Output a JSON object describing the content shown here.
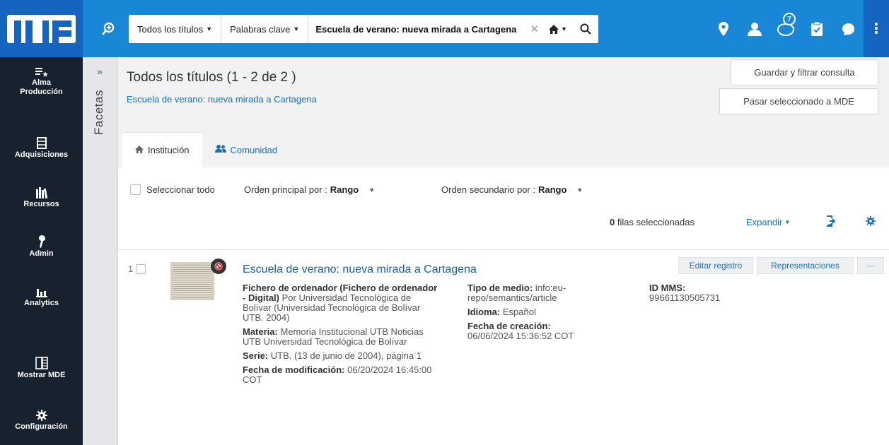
{
  "topbar": {
    "search_scope": "Todos los títulos",
    "search_field": "Palabras clave",
    "search_query": "Escuela de verano: nueva mirada a Cartagena",
    "notification_count": "7",
    "icons": [
      "zoom-search-icon",
      "location-pin-icon",
      "user-icon",
      "notifications-icon",
      "clipboard-icon",
      "chat-icon",
      "more-vertical-icon"
    ]
  },
  "nav": {
    "items": [
      {
        "label_1": "Alma",
        "label_2": "Producción",
        "icon": "list-star-icon"
      },
      {
        "label": "Adquisiciones",
        "icon": "ledger-icon"
      },
      {
        "label": "Recursos",
        "icon": "books-icon"
      },
      {
        "label": "Admin",
        "icon": "wrench-icon"
      },
      {
        "label": "Analytics",
        "icon": "bar-chart-icon"
      },
      {
        "label": "Mostrar MDE",
        "icon": "mde-icon"
      },
      {
        "label": "Configuración",
        "icon": "gear-icon"
      }
    ]
  },
  "facets": {
    "label": "Facetas",
    "toggle": "»"
  },
  "main": {
    "title": "Todos los títulos (1 - 2 de 2 )",
    "subtitle": "Escuela de verano: nueva mirada a Cartagena",
    "save_filter_button": "Guardar y filtrar consulta",
    "move_to_mde_button": "Pasar seleccionado a MDE",
    "tabs": [
      {
        "label": "Institución",
        "icon": "home-icon"
      },
      {
        "label": "Comunidad",
        "icon": "users-icon"
      }
    ]
  },
  "toolbar": {
    "select_all": "Seleccionar todo",
    "primary_sort_label": "Orden principal por :",
    "primary_sort_value": "Rango",
    "secondary_sort_label": "Orden secundario por :",
    "secondary_sort_value": "Rango",
    "selected_count": "0",
    "selected_label": "filas seleccionadas",
    "expand": "Expandir"
  },
  "result": {
    "index": "1",
    "title": "Escuela de verano: nueva mirada a Cartagena",
    "buttons": {
      "edit": "Editar registro",
      "representations": "Representaciones",
      "more": "···"
    },
    "format_bold": "Fichero de ordenador (Fichero de ordenador - Digital)",
    "format_rest": "Por Universidad Tecnológica de Bolívar (Universidad Tecnológica de Bolívar UTB. 2004)",
    "subject_label": "Materia:",
    "subject_value": "Memoria Institucional UTB Noticias UTB Universidad Tecnológica de Bolívar",
    "series_label": "Serie:",
    "series_value": "UTB. (13 de junio de 2004), página 1",
    "modified_label": "Fecha de modificación:",
    "modified_value": "06/20/2024 16:45:00 COT",
    "media_label": "Tipo de medio:",
    "media_value": "info:eu-repo/semantics/article",
    "language_label": "Idioma:",
    "language_value": "Español",
    "created_label": "Fecha de creación:",
    "created_value": "06/06/2024 15:36:52 COT",
    "mms_label": "ID MMS:",
    "mms_value": "99661130505731"
  }
}
